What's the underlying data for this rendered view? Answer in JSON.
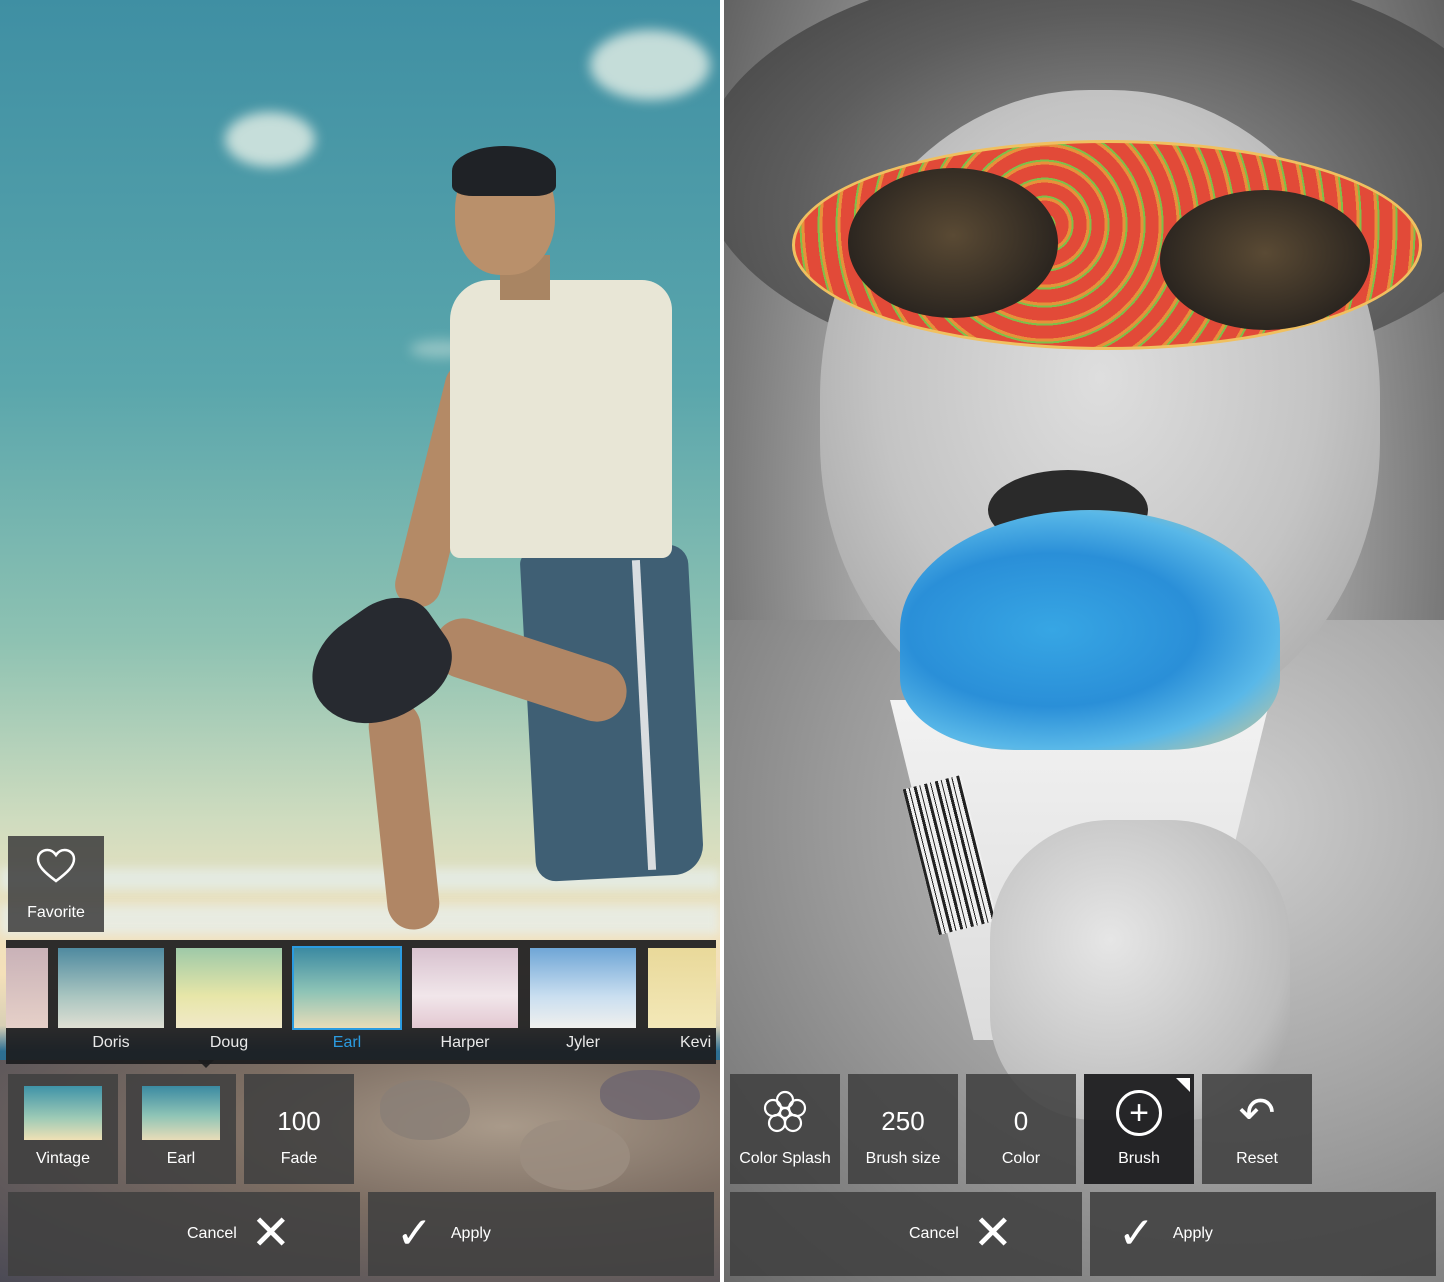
{
  "left": {
    "favorite": {
      "label": "Favorite",
      "icon": "heart-outline-icon"
    },
    "filters": [
      {
        "label": ""
      },
      {
        "label": "Doris"
      },
      {
        "label": "Doug"
      },
      {
        "label": "Earl"
      },
      {
        "label": "Harper"
      },
      {
        "label": "Jyler"
      },
      {
        "label": "Kevi"
      }
    ],
    "selected_filter": "Earl",
    "tools": {
      "vintage_label": "Vintage",
      "earl_label": "Earl",
      "fade_value": "100",
      "fade_label": "Fade"
    },
    "actions": {
      "cancel_label": "Cancel",
      "apply_label": "Apply"
    }
  },
  "right": {
    "tools": {
      "color_splash_label": "Color Splash",
      "brush_size_value": "250",
      "brush_size_label": "Brush size",
      "color_value": "0",
      "color_label": "Color",
      "brush_label": "Brush",
      "reset_label": "Reset"
    },
    "actions": {
      "cancel_label": "Cancel",
      "apply_label": "Apply"
    }
  },
  "colors": {
    "accent": "#2b9be0",
    "button_bg": "#404040",
    "strip_bg": "#1c1c1e"
  }
}
